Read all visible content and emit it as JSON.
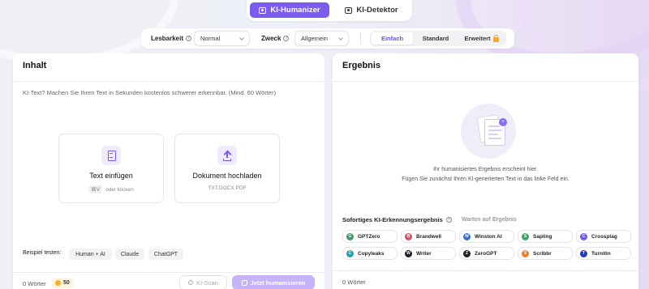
{
  "modes": {
    "humanizer": "KI-Humanizer",
    "detektor": "KI-Detektor"
  },
  "controls": {
    "lesbarkeit_label": "Lesbarkeit",
    "lesbarkeit_value": "Normal",
    "zweck_label": "Zweck",
    "zweck_value": "Allgemein",
    "levels": [
      "Einfach",
      "Standard",
      "Erweitert"
    ]
  },
  "left": {
    "title": "Inhalt",
    "hint": "KI-Text? Machen Sie Ihren Text in Sekunden kostenlos schwerer erkennbar. (Mind. 60 Wörter)",
    "paste_title": "Text einfügen",
    "paste_shortcut": "⌘V",
    "paste_or": "oder klicken",
    "upload_title": "Dokument hochladen",
    "upload_formats": "TXT.DOCX.PDF",
    "example_label": "Beispiel testen:",
    "examples": [
      "Human + AI",
      "Claude",
      "ChatGPT"
    ],
    "word_count": "0 Wörter",
    "credits": "50",
    "scan_button": "KI-Scan",
    "humanize_button": "Jetzt humanisieren"
  },
  "right": {
    "title": "Ergebnis",
    "empty_line1": "Ihr humanisiertes Ergebnis erscheint hier.",
    "empty_line2": "Fügen Sie zunächst Ihren KI-generierten Text in das linke Feld ein.",
    "detection_title": "Sofortiges KI-Erkennungsergebnis",
    "detection_status": "Warten auf Ergebnis",
    "detectors": [
      {
        "name": "GPTZero",
        "letter": "G",
        "color": "#3f9a6a"
      },
      {
        "name": "Brandwell",
        "letter": "B",
        "color": "#e0506a"
      },
      {
        "name": "Winston AI",
        "letter": "W",
        "color": "#2f6fe0"
      },
      {
        "name": "Sapling",
        "letter": "S",
        "color": "#3aa860"
      },
      {
        "name": "Crossplag",
        "letter": "C",
        "color": "#6a5cf0"
      },
      {
        "name": "Copyleaks",
        "letter": "C",
        "color": "#21a0b4"
      },
      {
        "name": "Writer",
        "letter": "W",
        "color": "#1d1d2c"
      },
      {
        "name": "ZeroGPT",
        "letter": "Z",
        "color": "#222222"
      },
      {
        "name": "Scribbr",
        "letter": "S",
        "color": "#f07b2a"
      },
      {
        "name": "Turnitin",
        "letter": "T",
        "color": "#1f3fbf"
      }
    ],
    "word_count": "0 Wörter"
  },
  "colors": {
    "accent": "#7c5cf0",
    "accent_light": "#c7b3fb"
  }
}
